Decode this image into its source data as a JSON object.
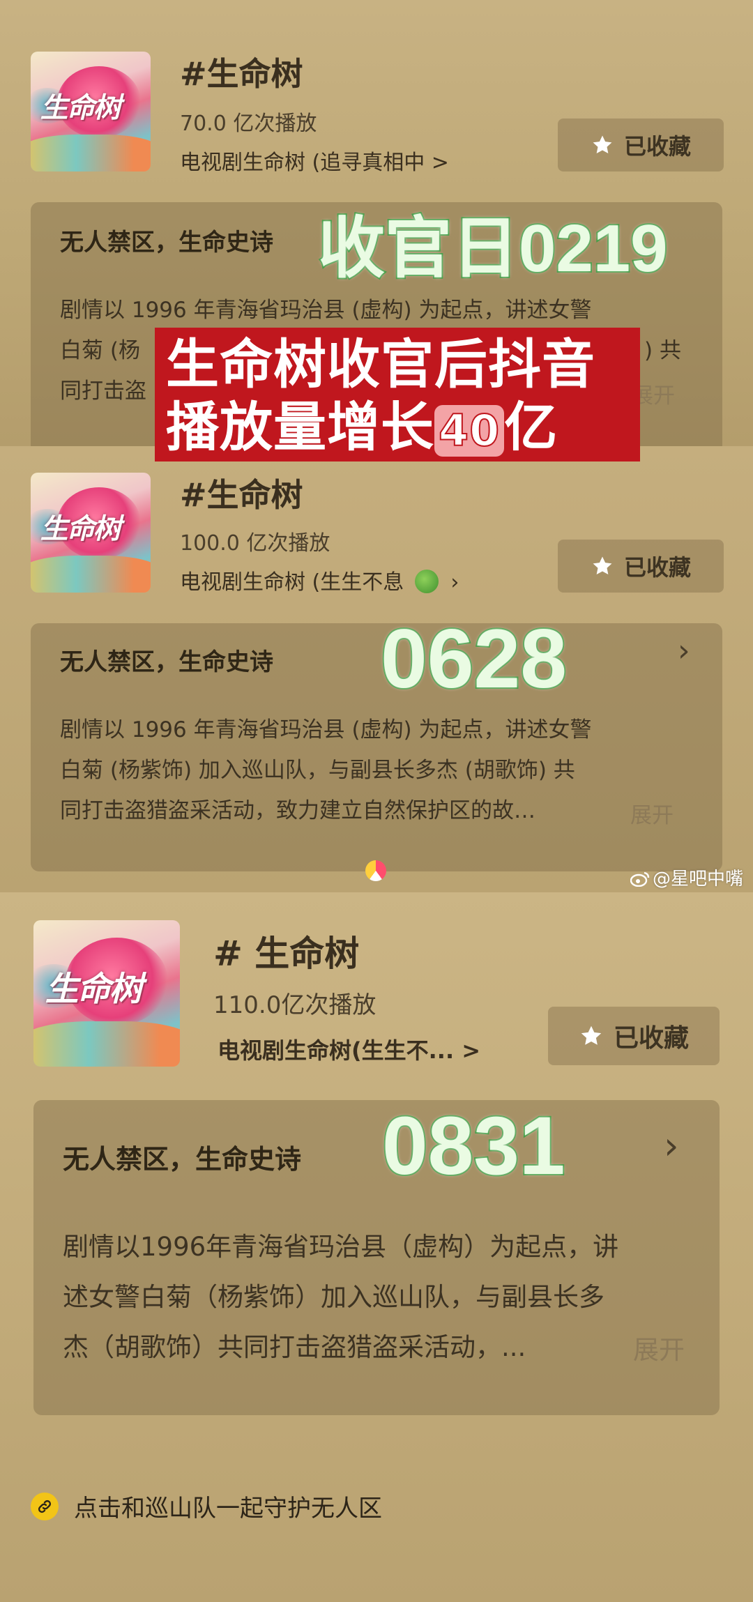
{
  "overlays": {
    "date_1": "收官日0219",
    "headline_line1": "生命树收官后抖音",
    "headline_line2_prefix": "播放量增长",
    "headline_number": "40",
    "headline_suffix": "亿",
    "date_2": "0628",
    "date_3": "0831"
  },
  "panel_1": {
    "poster_text": "生命树",
    "topic": "#生命树",
    "plays": "70.0 亿次播放",
    "drama": "电视剧生命树 (追寻真相中 >",
    "fav_label": "已收藏",
    "card_title": "无人禁区，生命史诗",
    "desc_line1": "剧情以 1996 年青海省玛治县 (虚构) 为起点，讲述女警",
    "desc_line2": "白菊 (杨",
    "desc_line2_end": ") 共",
    "desc_line3": "同打击盗",
    "more": "展开"
  },
  "panel_2": {
    "poster_text": "生命树",
    "topic": "#生命树",
    "plays": "100.0 亿次播放",
    "drama": "电视剧生命树 (生生不息",
    "fav_label": "已收藏",
    "card_title": "无人禁区，生命史诗",
    "chevron": "›",
    "desc_line1": "剧情以 1996 年青海省玛治县 (虚构) 为起点，讲述女警",
    "desc_line2": "白菊 (杨紫饰) 加入巡山队，与副县长多杰 (胡歌饰) 共",
    "desc_line3": "同打击盗猎盗采活动，致力建立自然保护区的故…",
    "more": "展开",
    "watermark": "@星吧中嘴"
  },
  "panel_3": {
    "poster_text": "生命树",
    "topic": "# 生命树",
    "plays": "110.0亿次播放",
    "drama": "电视剧生命树(生生不... >",
    "fav_label": "已收藏",
    "card_title": "无人禁区，生命史诗",
    "chevron": "›",
    "desc_line1": "剧情以1996年青海省玛治县（虚构）为起点，讲",
    "desc_line2": "述女警白菊（杨紫饰）加入巡山队，与副县长多",
    "desc_line3": "杰（胡歌饰）共同打击盗猎盗采活动，...",
    "more": "展开",
    "footer_link": "点击和巡山队一起守护无人区"
  }
}
